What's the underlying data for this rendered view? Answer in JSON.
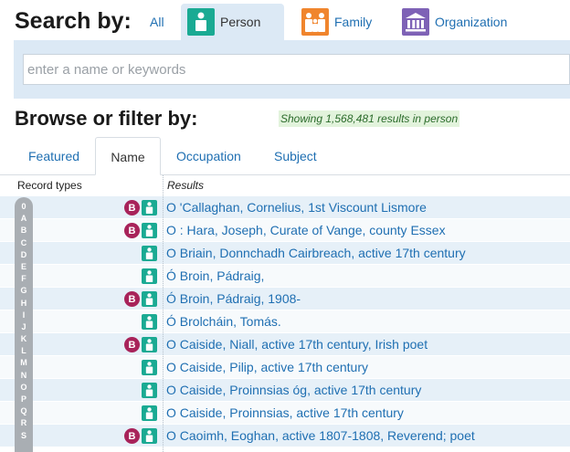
{
  "search": {
    "title": "Search by:",
    "tabs": [
      {
        "label": "All",
        "icon": "none"
      },
      {
        "label": "Person",
        "icon": "person-icon",
        "active": true
      },
      {
        "label": "Family",
        "icon": "family-icon"
      },
      {
        "label": "Organization",
        "icon": "organization-icon"
      }
    ],
    "placeholder": "enter a name or keywords",
    "value": ""
  },
  "browse": {
    "title": "Browse or filter by:",
    "showing": "Showing 1,568,481 results in person",
    "tabs": [
      {
        "label": "Featured"
      },
      {
        "label": "Name",
        "active": true
      },
      {
        "label": "Occupation"
      },
      {
        "label": "Subject"
      }
    ]
  },
  "table": {
    "record_types_header": "Record types",
    "results_header": "Results",
    "rows": [
      {
        "name": "O 'Callaghan, Cornelius, 1st Viscount Lismore",
        "biography": true
      },
      {
        "name": "O : Hara, Joseph, Curate of Vange, county Essex",
        "biography": true
      },
      {
        "name": "O Briain, Donnchadh Cairbreach, active 17th century",
        "biography": false
      },
      {
        "name": "Ó Broin, Pádraig,",
        "biography": false
      },
      {
        "name": "Ó Broin, Pádraig, 1908-",
        "biography": true
      },
      {
        "name": "Ó Brolcháin, Tomás.",
        "biography": false
      },
      {
        "name": "O Caiside, Niall, active 17th century, Irish poet",
        "biography": true
      },
      {
        "name": "O Caiside, Pilip, active 17th century",
        "biography": false
      },
      {
        "name": "O Caiside, Proinnsias óg, active 17th century",
        "biography": false
      },
      {
        "name": "O Caiside, Proinnsias, active 17th century",
        "biography": false
      },
      {
        "name": "O Caoimh, Eoghan, active 1807-1808, Reverend; poet",
        "biography": true
      }
    ],
    "badge_letter": "B"
  },
  "alphabet": [
    "0",
    "A",
    "B",
    "C",
    "D",
    "E",
    "F",
    "G",
    "H",
    "I",
    "J",
    "K",
    "L",
    "M",
    "N",
    "O",
    "P",
    "Q",
    "R",
    "S"
  ],
  "colors": {
    "accent": "#1f6fb2",
    "person": "#1aaa93",
    "family": "#f0852d",
    "organization": "#7e62b6",
    "biography_badge": "#a8235a",
    "search_panel": "#dce9f5"
  }
}
